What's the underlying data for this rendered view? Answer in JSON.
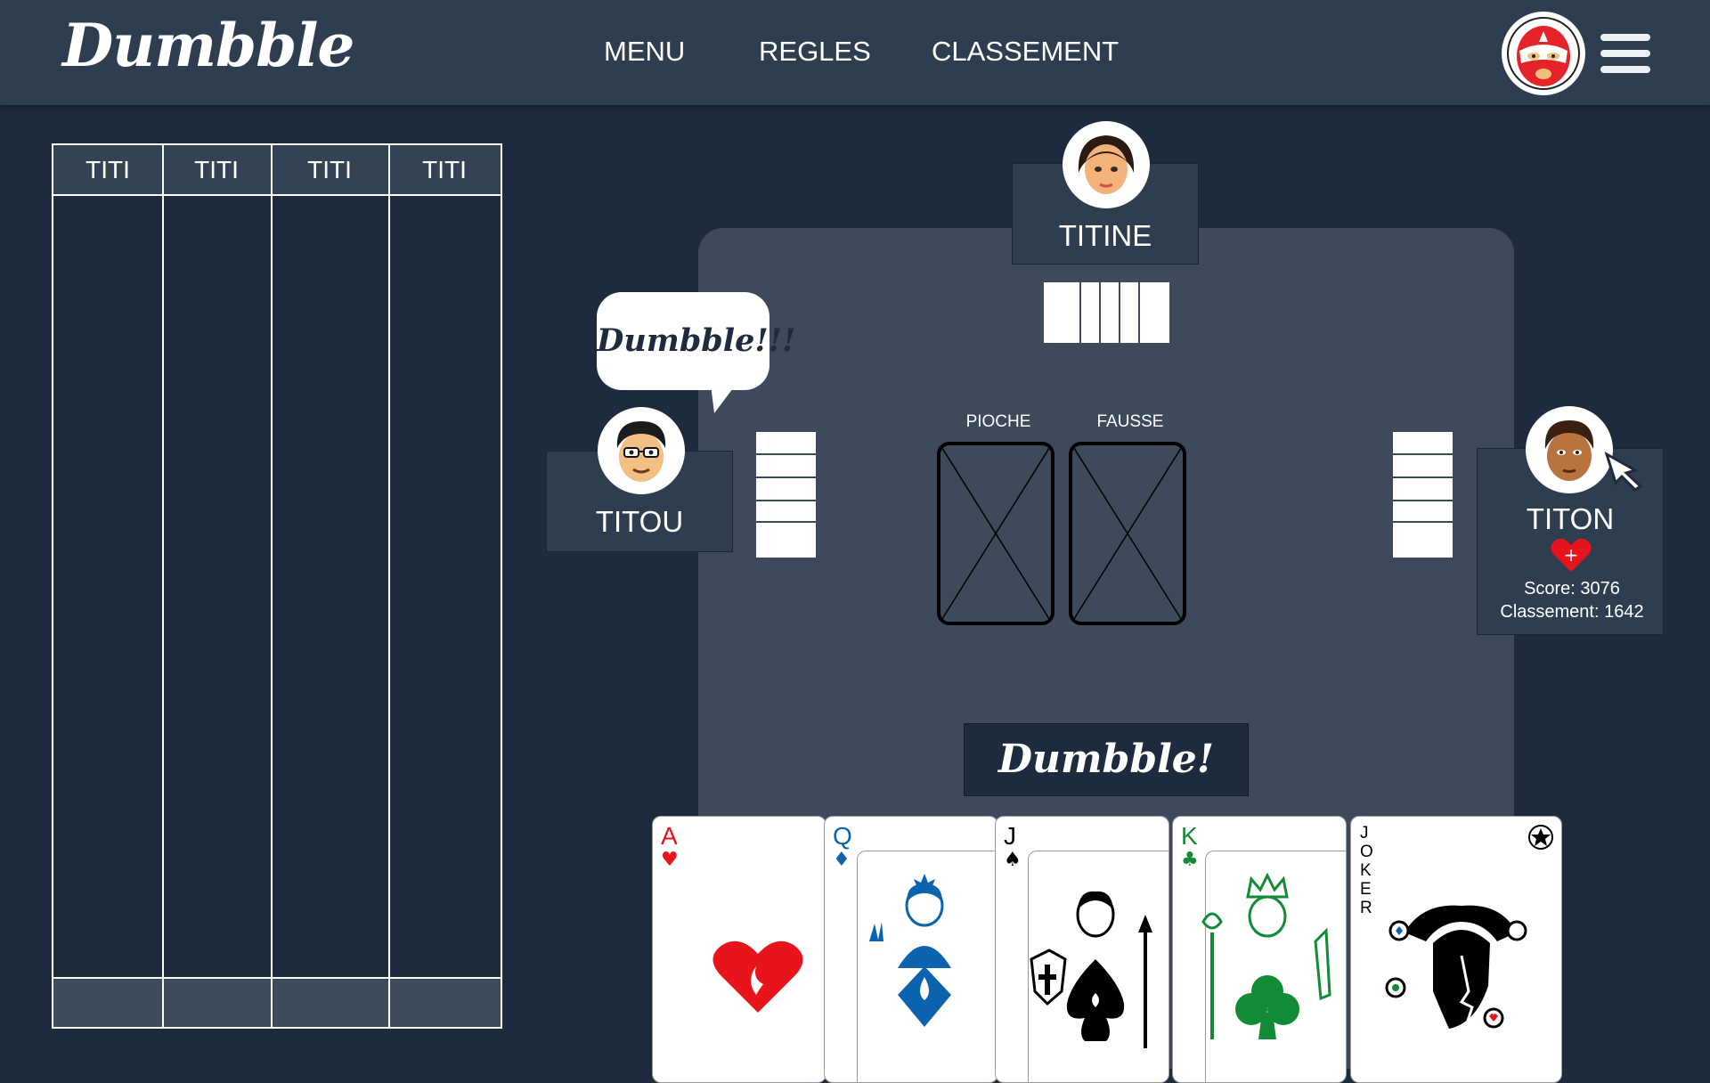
{
  "header": {
    "logo": "Dumbble",
    "nav": [
      "MENU",
      "REGLES",
      "CLASSEMENT"
    ]
  },
  "score_table": {
    "columns": [
      "TITI",
      "TITI",
      "TITI",
      "TITI"
    ]
  },
  "players": {
    "top": {
      "name": "TITINE",
      "cards_in_hand": 5
    },
    "left": {
      "name": "TITOU",
      "cards_in_hand": 5,
      "speech": "Dumbble!!!"
    },
    "right": {
      "name": "TITON",
      "cards_in_hand": 5,
      "score_label": "Score: 3076",
      "rank_label": "Classement: 1642"
    }
  },
  "piles": {
    "draw_label": "PIOCHE",
    "discard_label": "FAUSSE"
  },
  "dumbble_button": "Dumbble!",
  "hand": [
    {
      "rank": "A",
      "suit": "♥",
      "color": "#e8141c"
    },
    {
      "rank": "Q",
      "suit": "♦",
      "color": "#0b63ad"
    },
    {
      "rank": "J",
      "suit": "♠",
      "color": "#000000"
    },
    {
      "rank": "K",
      "suit": "♣",
      "color": "#138a36"
    },
    {
      "rank": "JOKER",
      "suit": "★",
      "color": "#000000"
    }
  ],
  "colors": {
    "background": "#1e2a3d",
    "header": "#2f3d50",
    "table_mat": "#3e4a5c",
    "heart": "#e8141c"
  },
  "icons": [
    "luchador-avatar-icon",
    "hamburger-menu-icon",
    "heart-plus-icon",
    "cursor-arrow-icon"
  ]
}
